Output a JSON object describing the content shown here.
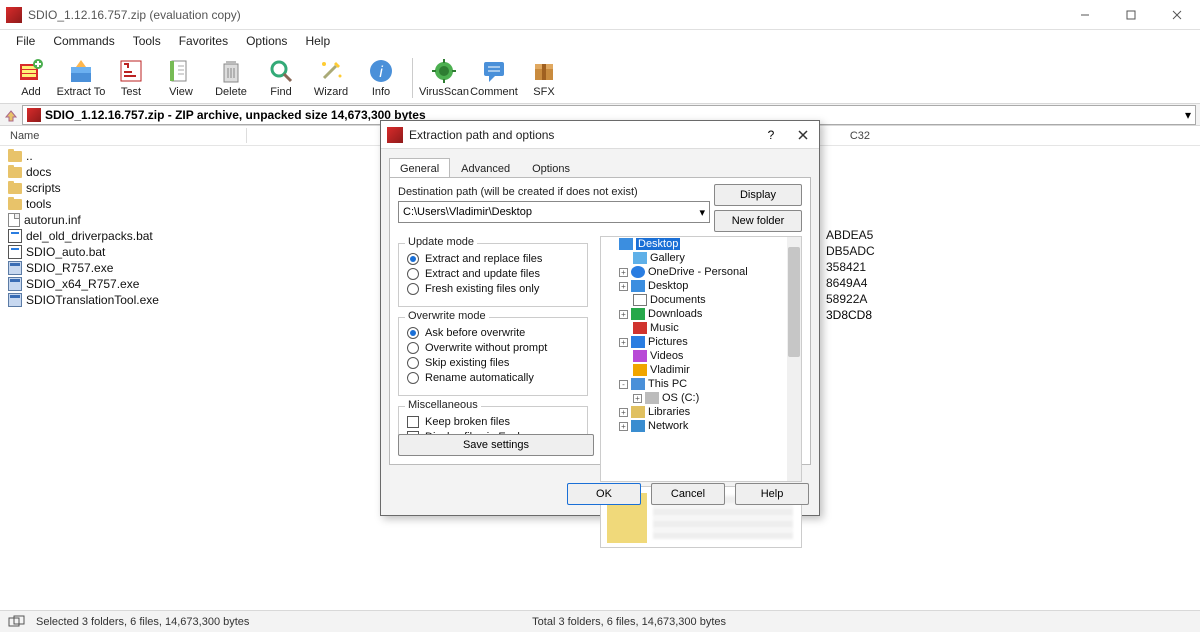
{
  "window": {
    "title": "SDIO_1.12.16.757.zip (evaluation copy)"
  },
  "menu": [
    "File",
    "Commands",
    "Tools",
    "Favorites",
    "Options",
    "Help"
  ],
  "toolbar": [
    {
      "label": "Add",
      "icon": "add"
    },
    {
      "label": "Extract To",
      "icon": "extract"
    },
    {
      "label": "Test",
      "icon": "test"
    },
    {
      "label": "View",
      "icon": "view"
    },
    {
      "label": "Delete",
      "icon": "delete"
    },
    {
      "label": "Find",
      "icon": "find"
    },
    {
      "label": "Wizard",
      "icon": "wizard"
    },
    {
      "label": "Info",
      "icon": "info"
    },
    {
      "label": "VirusScan",
      "icon": "virus"
    },
    {
      "label": "Comment",
      "icon": "comment"
    },
    {
      "label": "SFX",
      "icon": "sfx"
    }
  ],
  "pathbar": "SDIO_1.12.16.757.zip - ZIP archive, unpacked size 14,673,300 bytes",
  "columns": {
    "name": "Name",
    "crc": "C32"
  },
  "files": [
    {
      "name": "..",
      "type": "folder",
      "crc": ""
    },
    {
      "name": "docs",
      "type": "folder",
      "crc": ""
    },
    {
      "name": "scripts",
      "type": "folder",
      "crc": ""
    },
    {
      "name": "tools",
      "type": "folder",
      "crc": ""
    },
    {
      "name": "autorun.inf",
      "type": "file",
      "crc": ""
    },
    {
      "name": "del_old_driverpacks.bat",
      "type": "bat",
      "crc": "ABDEA5"
    },
    {
      "name": "SDIO_auto.bat",
      "type": "bat",
      "crc": "DB5ADC"
    },
    {
      "name": "SDIO_R757.exe",
      "type": "exe",
      "crc": "358421"
    },
    {
      "name": "SDIO_x64_R757.exe",
      "type": "exe",
      "crc": "8649A4"
    },
    {
      "name": "SDIOTranslationTool.exe",
      "type": "exe",
      "crc": "58922A"
    }
  ],
  "extra_crc": "3D8CD8",
  "statusbar": {
    "left": "Selected 3 folders, 6 files, 14,673,300 bytes",
    "right": "Total 3 folders, 6 files, 14,673,300 bytes"
  },
  "dialog": {
    "title": "Extraction path and options",
    "tabs": [
      "General",
      "Advanced",
      "Options"
    ],
    "active_tab": 0,
    "dest_label": "Destination path (will be created if does not exist)",
    "dest_path": "C:\\Users\\Vladimir\\Desktop",
    "btn_display": "Display",
    "btn_newfolder": "New folder",
    "update_mode": {
      "title": "Update mode",
      "options": [
        "Extract and replace files",
        "Extract and update files",
        "Fresh existing files only"
      ],
      "selected": 0
    },
    "overwrite_mode": {
      "title": "Overwrite mode",
      "options": [
        "Ask before overwrite",
        "Overwrite without prompt",
        "Skip existing files",
        "Rename automatically"
      ],
      "selected": 0
    },
    "misc": {
      "title": "Miscellaneous",
      "options": [
        "Keep broken files",
        "Display files in Explorer"
      ]
    },
    "save_settings": "Save settings",
    "tree": [
      {
        "label": "Desktop",
        "icon": "folder",
        "indent": 0,
        "exp": "",
        "sel": true
      },
      {
        "label": "Gallery",
        "icon": "img",
        "indent": 1,
        "exp": ""
      },
      {
        "label": "OneDrive - Personal",
        "icon": "cloud",
        "indent": 1,
        "exp": "+"
      },
      {
        "label": "Desktop",
        "icon": "folder",
        "indent": 1,
        "exp": "+"
      },
      {
        "label": "Documents",
        "icon": "doc",
        "indent": 1,
        "exp": ""
      },
      {
        "label": "Downloads",
        "icon": "down",
        "indent": 1,
        "exp": "+"
      },
      {
        "label": "Music",
        "icon": "music",
        "indent": 1,
        "exp": ""
      },
      {
        "label": "Pictures",
        "icon": "pic",
        "indent": 1,
        "exp": "+"
      },
      {
        "label": "Videos",
        "icon": "vid",
        "indent": 1,
        "exp": ""
      },
      {
        "label": "Vladimir",
        "icon": "home",
        "indent": 1,
        "exp": ""
      },
      {
        "label": "This PC",
        "icon": "pc",
        "indent": 1,
        "exp": "-"
      },
      {
        "label": "OS (C:)",
        "icon": "disk",
        "indent": 2,
        "exp": "+"
      },
      {
        "label": "Libraries",
        "icon": "lib",
        "indent": 1,
        "exp": "+"
      },
      {
        "label": "Network",
        "icon": "net",
        "indent": 1,
        "exp": "+"
      }
    ],
    "footer": {
      "ok": "OK",
      "cancel": "Cancel",
      "help": "Help"
    }
  }
}
